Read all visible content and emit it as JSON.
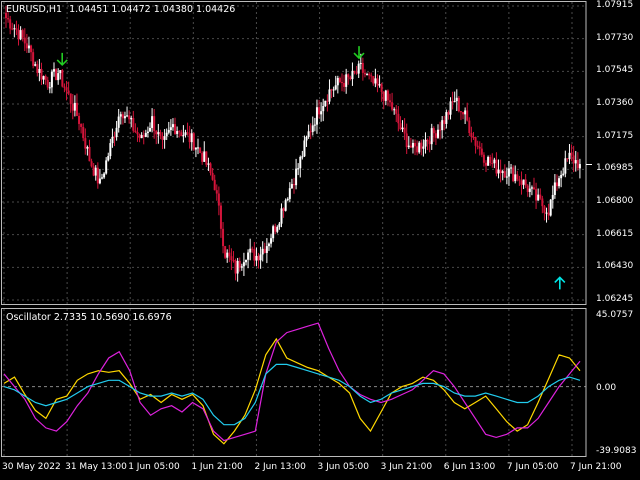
{
  "header": {
    "symbol": "EURUSD,H1",
    "ohlc": "1.04451 1.04472 1.04380 1.04426"
  },
  "oscillator": {
    "label": "Oscillator 2.7335 10.5690 16.6976",
    "max_label": "45.0757",
    "zero_label": "0.00",
    "min_label": "-39.9083"
  },
  "price_axis": {
    "ticks": [
      "1.07915",
      "1.07730",
      "1.07545",
      "1.07360",
      "1.07175",
      "1.06985",
      "1.06800",
      "1.06615",
      "1.06430",
      "1.06245"
    ]
  },
  "time_axis": {
    "ticks": [
      "30 May 2022",
      "31 May 13:00",
      "1 Jun 05:00",
      "1 Jun 21:00",
      "2 Jun 13:00",
      "3 Jun 05:00",
      "3 Jun 21:00",
      "6 Jun 13:00",
      "7 Jun 05:00",
      "7 Jun 21:00"
    ]
  },
  "colors": {
    "background": "#000000",
    "grid": "#4a4a4a",
    "bull": "#ffffff",
    "bear": "#d4143a",
    "down_arrow": "#22cc22",
    "up_arrow": "#00e5e5",
    "osc_yellow": "#ffd800",
    "osc_magenta": "#dd22dd",
    "osc_cyan": "#22ccee",
    "osc_zero": "#888888"
  },
  "chart_data": [
    {
      "type": "candlestick",
      "y_axis_range": [
        1.0622,
        1.0795
      ],
      "close_series": [
        1.0788,
        1.0781,
        1.0772,
        1.0758,
        1.075,
        1.0756,
        1.0742,
        1.0728,
        1.0705,
        1.069,
        1.0712,
        1.0735,
        1.0725,
        1.0716,
        1.0728,
        1.0712,
        1.0725,
        1.072,
        1.0715,
        1.0705,
        1.069,
        1.065,
        1.064,
        1.065,
        1.0648,
        1.0655,
        1.0668,
        1.0685,
        1.07,
        1.072,
        1.0735,
        1.0745,
        1.075,
        1.0752,
        1.0758,
        1.075,
        1.0745,
        1.0735,
        1.072,
        1.071,
        1.0715,
        1.072,
        1.0728,
        1.074,
        1.073,
        1.0715,
        1.0705,
        1.07,
        1.0698,
        1.0695,
        1.0688,
        1.068,
        1.0675,
        1.0695,
        1.0706,
        1.0702
      ],
      "markers": [
        {
          "kind": "down_arrow",
          "price": 1.0758
        },
        {
          "kind": "down_arrow",
          "price": 1.0762
        },
        {
          "kind": "up_arrow",
          "price": 1.064
        }
      ]
    },
    {
      "type": "line",
      "y_axis_range": [
        -39.9083,
        45.0757
      ],
      "series": [
        {
          "color": "#ffd800",
          "values": [
            2,
            6,
            -5,
            -15,
            -20,
            -8,
            -6,
            4,
            8,
            10,
            9,
            10,
            2,
            -8,
            -5,
            -10,
            -5,
            -8,
            -5,
            -12,
            -30,
            -36,
            -28,
            -18,
            -2,
            20,
            30,
            18,
            15,
            12,
            10,
            6,
            2,
            -4,
            -20,
            -28,
            -16,
            -4,
            0,
            2,
            6,
            4,
            -2,
            -10,
            -14,
            -10,
            -6,
            -14,
            -22,
            -28,
            -24,
            -10,
            5,
            20,
            18,
            10
          ]
        },
        {
          "color": "#dd22dd",
          "values": [
            8,
            0,
            -8,
            -20,
            -26,
            -28,
            -22,
            -12,
            -4,
            8,
            18,
            22,
            10,
            -10,
            -18,
            -14,
            -12,
            -16,
            -10,
            -14,
            -28,
            -34,
            -32,
            -30,
            -28,
            8,
            28,
            34,
            36,
            38,
            40,
            24,
            10,
            0,
            -5,
            -8,
            -10,
            -8,
            -5,
            -2,
            4,
            10,
            8,
            0,
            -10,
            -20,
            -30,
            -32,
            -30,
            -26,
            -26,
            -20,
            -10,
            0,
            8,
            16
          ]
        },
        {
          "color": "#22ccee",
          "values": [
            0,
            -2,
            -6,
            -10,
            -12,
            -10,
            -8,
            -4,
            0,
            2,
            4,
            4,
            0,
            -4,
            -6,
            -6,
            -4,
            -6,
            -4,
            -8,
            -18,
            -24,
            -24,
            -20,
            -10,
            8,
            14,
            14,
            12,
            10,
            8,
            6,
            4,
            0,
            -6,
            -10,
            -8,
            -4,
            -2,
            0,
            2,
            2,
            0,
            -4,
            -6,
            -6,
            -4,
            -6,
            -8,
            -10,
            -10,
            -6,
            0,
            4,
            6,
            4
          ]
        }
      ]
    }
  ]
}
